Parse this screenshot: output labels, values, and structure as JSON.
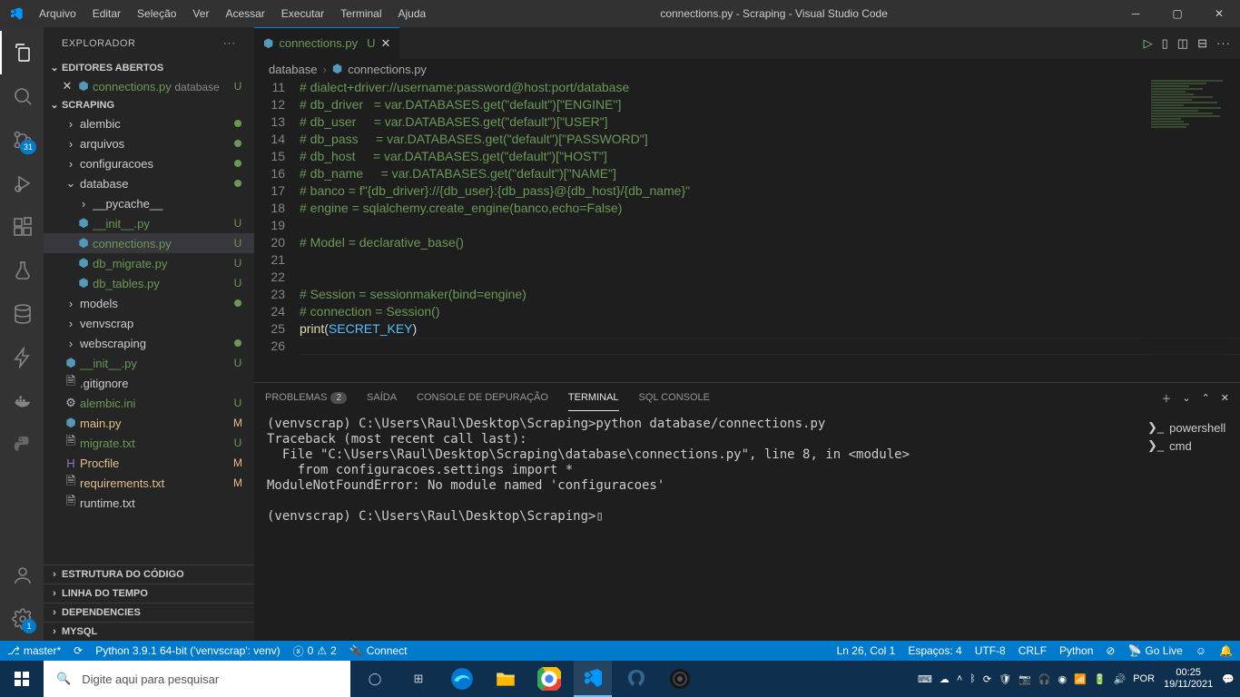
{
  "title": "connections.py - Scraping - Visual Studio Code",
  "menu": [
    "Arquivo",
    "Editar",
    "Seleção",
    "Ver",
    "Acessar",
    "Executar",
    "Terminal",
    "Ajuda"
  ],
  "activity": {
    "scm_badge": "31",
    "settings_badge": "1"
  },
  "sidebar": {
    "title": "EXPLORADOR",
    "openEditors": "EDITORES ABERTOS",
    "openFile": {
      "name": "connections.py",
      "path": "database",
      "status": "U"
    },
    "workspace": "SCRAPING",
    "tree": [
      {
        "t": "folder",
        "l": "alembic",
        "d": 1,
        "mod": true
      },
      {
        "t": "folder",
        "l": "arquivos",
        "d": 1,
        "mod": true
      },
      {
        "t": "folder",
        "l": "configuracoes",
        "d": 1,
        "mod": true
      },
      {
        "t": "folder-open",
        "l": "database",
        "d": 1,
        "mod": true
      },
      {
        "t": "folder",
        "l": "__pycache__",
        "d": 2
      },
      {
        "t": "py",
        "l": "__init__.py",
        "d": 2,
        "s": "U"
      },
      {
        "t": "py",
        "l": "connections.py",
        "d": 2,
        "s": "U",
        "sel": true
      },
      {
        "t": "py",
        "l": "db_migrate.py",
        "d": 2,
        "s": "U"
      },
      {
        "t": "py",
        "l": "db_tables.py",
        "d": 2,
        "s": "U"
      },
      {
        "t": "folder",
        "l": "models",
        "d": 1,
        "mod": true
      },
      {
        "t": "folder",
        "l": "venvscrap",
        "d": 1
      },
      {
        "t": "folder",
        "l": "webscraping",
        "d": 1,
        "mod": true
      },
      {
        "t": "py",
        "l": "__init__.py",
        "d": 1,
        "s": "U"
      },
      {
        "t": "file",
        "l": ".gitignore",
        "d": 1
      },
      {
        "t": "ini",
        "l": "alembic.ini",
        "d": 1,
        "s": "U"
      },
      {
        "t": "py",
        "l": "main.py",
        "d": 1,
        "s": "M"
      },
      {
        "t": "txt",
        "l": "migrate.txt",
        "d": 1,
        "s": "U"
      },
      {
        "t": "proc",
        "l": "Procfile",
        "d": 1,
        "s": "M"
      },
      {
        "t": "txt",
        "l": "requirements.txt",
        "d": 1,
        "s": "M"
      },
      {
        "t": "txt",
        "l": "runtime.txt",
        "d": 1
      }
    ],
    "bottom": [
      "ESTRUTURA DO CÓDIGO",
      "LINHA DO TEMPO",
      "DEPENDENCIES",
      "MYSQL"
    ]
  },
  "tab": {
    "file": "connections.py",
    "suffix": "U"
  },
  "breadcrumb": [
    "database",
    "connections.py"
  ],
  "code": {
    "start": 11,
    "lines": [
      {
        "t": "comment",
        "v": "# dialect+driver://username:password@host:port/database"
      },
      {
        "t": "comment",
        "v": "# db_driver   = var.DATABASES.get(\"default\")[\"ENGINE\"]"
      },
      {
        "t": "comment",
        "v": "# db_user     = var.DATABASES.get(\"default\")[\"USER\"]"
      },
      {
        "t": "comment",
        "v": "# db_pass     = var.DATABASES.get(\"default\")[\"PASSWORD\"]"
      },
      {
        "t": "comment",
        "v": "# db_host     = var.DATABASES.get(\"default\")[\"HOST\"]"
      },
      {
        "t": "comment",
        "v": "# db_name     = var.DATABASES.get(\"default\")[\"NAME\"]"
      },
      {
        "t": "comment",
        "v": "# banco = f\"{db_driver}://{db_user}:{db_pass}@{db_host}/{db_name}\""
      },
      {
        "t": "comment",
        "v": "# engine = sqlalchemy.create_engine(banco,echo=False)"
      },
      {
        "t": "plain",
        "v": ""
      },
      {
        "t": "comment",
        "v": "# Model = declarative_base()"
      },
      {
        "t": "plain",
        "v": ""
      },
      {
        "t": "plain",
        "v": ""
      },
      {
        "t": "comment",
        "v": "# Session = sessionmaker(bind=engine)"
      },
      {
        "t": "comment",
        "v": "# connection = Session()"
      },
      {
        "t": "print",
        "fn": "print",
        "var": "SECRET_KEY"
      },
      {
        "t": "plain",
        "v": ""
      }
    ]
  },
  "panel": {
    "tabs": {
      "problems": "PROBLEMAS",
      "problems_count": "2",
      "output": "SAÍDA",
      "debug": "CONSOLE DE DEPURAÇÃO",
      "terminal": "TERMINAL",
      "sql": "SQL CONSOLE"
    },
    "terminals": [
      "powershell",
      "cmd"
    ],
    "terminal_text": "(venvscrap) C:\\Users\\Raul\\Desktop\\Scraping>python database/connections.py\nTraceback (most recent call last):\n  File \"C:\\Users\\Raul\\Desktop\\Scraping\\database\\connections.py\", line 8, in <module>\n    from configuracoes.settings import *\nModuleNotFoundError: No module named 'configuracoes'\n\n(venvscrap) C:\\Users\\Raul\\Desktop\\Scraping>▯"
  },
  "status": {
    "branch": "master*",
    "python": "Python 3.9.1 64-bit ('venvscrap': venv)",
    "errors": "0",
    "warnings": "2",
    "connect": "Connect",
    "pos": "Ln 26, Col 1",
    "spaces": "Espaços: 4",
    "enc": "UTF-8",
    "eol": "CRLF",
    "lang": "Python",
    "golive": "Go Live"
  },
  "taskbar": {
    "search": "Digite aqui para pesquisar",
    "time": "00:25",
    "date": "19/11/2021",
    "lang": "POR"
  }
}
